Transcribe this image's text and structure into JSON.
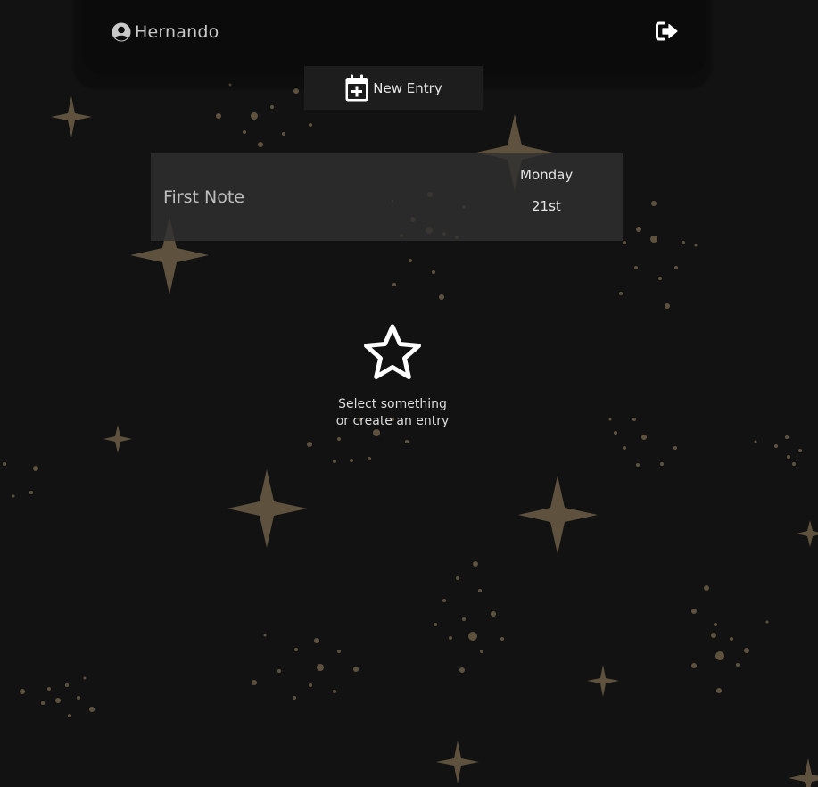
{
  "user": {
    "name": "Hernando",
    "icon": "user-circle-icon"
  },
  "header": {
    "logout_icon": "logout-icon"
  },
  "new_entry": {
    "label": "New Entry",
    "icon": "calendar-plus-icon"
  },
  "entries": [
    {
      "title": "First Note",
      "day": "Monday",
      "date": "21st"
    }
  ],
  "empty_state": {
    "icon": "star-outline-icon",
    "line1": "Select something",
    "line2": "or create an entry"
  },
  "colors": {
    "background": "#121212",
    "sparkle": "#5e523f",
    "text": "#e6e6e6"
  }
}
